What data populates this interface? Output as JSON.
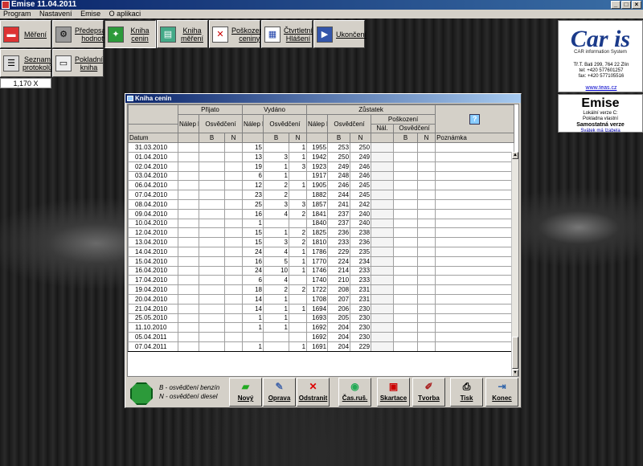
{
  "window": {
    "title": "Emise 11.04.2011"
  },
  "menu": [
    "Program",
    "Nastavení",
    "Emise",
    "O aplikaci"
  ],
  "toolbar": [
    {
      "label": "Měření",
      "icon": "car-icon"
    },
    {
      "label": "Předepsané hodnoty",
      "icon": "engine-icon"
    },
    {
      "label": "Kniha cenin",
      "icon": "stamp-icon"
    },
    {
      "label": "Kniha měření",
      "icon": "book-icon"
    },
    {
      "label": "Poškozené ceniny",
      "icon": "damaged-stamp-icon"
    },
    {
      "label": "Čtvrtletní Hlášení",
      "icon": "report-icon"
    },
    {
      "label": "Ukončení",
      "icon": "exit-door-icon"
    },
    {
      "label": "Seznam protokolů",
      "icon": "list-icon"
    },
    {
      "label": "Pokladní kniha",
      "icon": "cash-book-icon"
    }
  ],
  "counter": "1,170 X",
  "caris": {
    "logo": "Car is",
    "logo_sub": "CAR information System",
    "address": [
      "Tř.T. Bati 299, 764 22 Zlín",
      "tel: +420 577601257",
      "fax: +420 577105516"
    ],
    "url": "www.teas.cz"
  },
  "emise_panel": {
    "title": "Emise",
    "lines": [
      "Lokální verze C:",
      "Pokladna vlastní"
    ],
    "mode": "Samostatná verze",
    "nameday": "Svátek má Izabela"
  },
  "dialog": {
    "title": "Kniha cenin",
    "headers": {
      "prijato": "Přijato",
      "vydano": "Vydáno",
      "zustatek": "Zůstatek",
      "naleky": "Nálep ky",
      "osvedceni": "Osvědčení",
      "poskozeni": "Poškození",
      "nal": "Nál.",
      "b": "B",
      "n": "N",
      "datum": "Datum",
      "poznamka": "Poznámka",
      "help": "?"
    },
    "rows": [
      {
        "date": "31.03.2010",
        "pn": "",
        "pb": "",
        "pnn": "",
        "vn": "15",
        "vb": "",
        "vnn": "1",
        "zn": "1955",
        "zb": "253",
        "znn": "250",
        "dn": "",
        "db": "",
        "dnn": "",
        "note": ""
      },
      {
        "date": "01.04.2010",
        "pn": "",
        "pb": "",
        "pnn": "",
        "vn": "13",
        "vb": "3",
        "vnn": "1",
        "zn": "1942",
        "zb": "250",
        "znn": "249",
        "dn": "",
        "db": "",
        "dnn": "",
        "note": ""
      },
      {
        "date": "02.04.2010",
        "pn": "",
        "pb": "",
        "pnn": "",
        "vn": "19",
        "vb": "1",
        "vnn": "3",
        "zn": "1923",
        "zb": "249",
        "znn": "246",
        "dn": "",
        "db": "",
        "dnn": "",
        "note": ""
      },
      {
        "date": "03.04.2010",
        "pn": "",
        "pb": "",
        "pnn": "",
        "vn": "6",
        "vb": "1",
        "vnn": "",
        "zn": "1917",
        "zb": "248",
        "znn": "246",
        "dn": "",
        "db": "",
        "dnn": "",
        "note": ""
      },
      {
        "date": "06.04.2010",
        "pn": "",
        "pb": "",
        "pnn": "",
        "vn": "12",
        "vb": "2",
        "vnn": "1",
        "zn": "1905",
        "zb": "246",
        "znn": "245",
        "dn": "",
        "db": "",
        "dnn": "",
        "note": ""
      },
      {
        "date": "07.04.2010",
        "pn": "",
        "pb": "",
        "pnn": "",
        "vn": "23",
        "vb": "2",
        "vnn": "",
        "zn": "1882",
        "zb": "244",
        "znn": "245",
        "dn": "",
        "db": "",
        "dnn": "",
        "note": ""
      },
      {
        "date": "08.04.2010",
        "pn": "",
        "pb": "",
        "pnn": "",
        "vn": "25",
        "vb": "3",
        "vnn": "3",
        "zn": "1857",
        "zb": "241",
        "znn": "242",
        "dn": "",
        "db": "",
        "dnn": "",
        "note": ""
      },
      {
        "date": "09.04.2010",
        "pn": "",
        "pb": "",
        "pnn": "",
        "vn": "16",
        "vb": "4",
        "vnn": "2",
        "zn": "1841",
        "zb": "237",
        "znn": "240",
        "dn": "",
        "db": "",
        "dnn": "",
        "note": ""
      },
      {
        "date": "10.04.2010",
        "pn": "",
        "pb": "",
        "pnn": "",
        "vn": "1",
        "vb": "",
        "vnn": "",
        "zn": "1840",
        "zb": "237",
        "znn": "240",
        "dn": "",
        "db": "",
        "dnn": "",
        "note": ""
      },
      {
        "date": "12.04.2010",
        "pn": "",
        "pb": "",
        "pnn": "",
        "vn": "15",
        "vb": "1",
        "vnn": "2",
        "zn": "1825",
        "zb": "236",
        "znn": "238",
        "dn": "",
        "db": "",
        "dnn": "",
        "note": ""
      },
      {
        "date": "13.04.2010",
        "pn": "",
        "pb": "",
        "pnn": "",
        "vn": "15",
        "vb": "3",
        "vnn": "2",
        "zn": "1810",
        "zb": "233",
        "znn": "236",
        "dn": "",
        "db": "",
        "dnn": "",
        "note": ""
      },
      {
        "date": "14.04.2010",
        "pn": "",
        "pb": "",
        "pnn": "",
        "vn": "24",
        "vb": "4",
        "vnn": "1",
        "zn": "1786",
        "zb": "229",
        "znn": "235",
        "dn": "",
        "db": "",
        "dnn": "",
        "note": ""
      },
      {
        "date": "15.04.2010",
        "pn": "",
        "pb": "",
        "pnn": "",
        "vn": "16",
        "vb": "5",
        "vnn": "1",
        "zn": "1770",
        "zb": "224",
        "znn": "234",
        "dn": "",
        "db": "",
        "dnn": "",
        "note": ""
      },
      {
        "date": "16.04.2010",
        "pn": "",
        "pb": "",
        "pnn": "",
        "vn": "24",
        "vb": "10",
        "vnn": "1",
        "zn": "1746",
        "zb": "214",
        "znn": "233",
        "dn": "",
        "db": "",
        "dnn": "",
        "note": ""
      },
      {
        "date": "17.04.2010",
        "pn": "",
        "pb": "",
        "pnn": "",
        "vn": "6",
        "vb": "4",
        "vnn": "",
        "zn": "1740",
        "zb": "210",
        "znn": "233",
        "dn": "",
        "db": "",
        "dnn": "",
        "note": ""
      },
      {
        "date": "19.04.2010",
        "pn": "",
        "pb": "",
        "pnn": "",
        "vn": "18",
        "vb": "2",
        "vnn": "2",
        "zn": "1722",
        "zb": "208",
        "znn": "231",
        "dn": "",
        "db": "",
        "dnn": "",
        "note": ""
      },
      {
        "date": "20.04.2010",
        "pn": "",
        "pb": "",
        "pnn": "",
        "vn": "14",
        "vb": "1",
        "vnn": "",
        "zn": "1708",
        "zb": "207",
        "znn": "231",
        "dn": "",
        "db": "",
        "dnn": "",
        "note": ""
      },
      {
        "date": "21.04.2010",
        "pn": "",
        "pb": "",
        "pnn": "",
        "vn": "14",
        "vb": "1",
        "vnn": "1",
        "zn": "1694",
        "zb": "206",
        "znn": "230",
        "dn": "",
        "db": "",
        "dnn": "",
        "note": ""
      },
      {
        "date": "25.05.2010",
        "pn": "",
        "pb": "",
        "pnn": "",
        "vn": "1",
        "vb": "1",
        "vnn": "",
        "zn": "1693",
        "zb": "205",
        "znn": "230",
        "dn": "",
        "db": "",
        "dnn": "",
        "note": ""
      },
      {
        "date": "11.10.2010",
        "pn": "",
        "pb": "",
        "pnn": "",
        "vn": "1",
        "vb": "1",
        "vnn": "",
        "zn": "1692",
        "zb": "204",
        "znn": "230",
        "dn": "",
        "db": "",
        "dnn": "",
        "note": ""
      },
      {
        "date": "05.04.2011",
        "pn": "",
        "pb": "",
        "pnn": "",
        "vn": "",
        "vb": "",
        "vnn": "",
        "zn": "1692",
        "zb": "204",
        "znn": "230",
        "dn": "",
        "db": "",
        "dnn": "",
        "note": ""
      },
      {
        "date": "07.04.2011",
        "pn": "",
        "pb": "",
        "pnn": "",
        "vn": "1",
        "vb": "",
        "vnn": "1",
        "zn": "1691",
        "zb": "204",
        "znn": "229",
        "dn": "",
        "db": "",
        "dnn": "",
        "note": ""
      }
    ],
    "legend": [
      "B - osvědčení benzín",
      "N - osvědčení diesel"
    ],
    "buttons": [
      {
        "label": "Nový",
        "icon": "new-folder-icon"
      },
      {
        "label": "Oprava",
        "icon": "edit-icon"
      },
      {
        "label": "Odstranit",
        "icon": "delete-x-icon"
      },
      {
        "label": "Čas.ruš.",
        "icon": "timer-cancel-icon"
      },
      {
        "label": "Skartace",
        "icon": "shred-icon"
      },
      {
        "label": "Tvorba",
        "icon": "create-pencil-icon"
      },
      {
        "label": "Tisk",
        "icon": "printer-icon"
      },
      {
        "label": "Konec",
        "icon": "exit-icon"
      }
    ]
  }
}
